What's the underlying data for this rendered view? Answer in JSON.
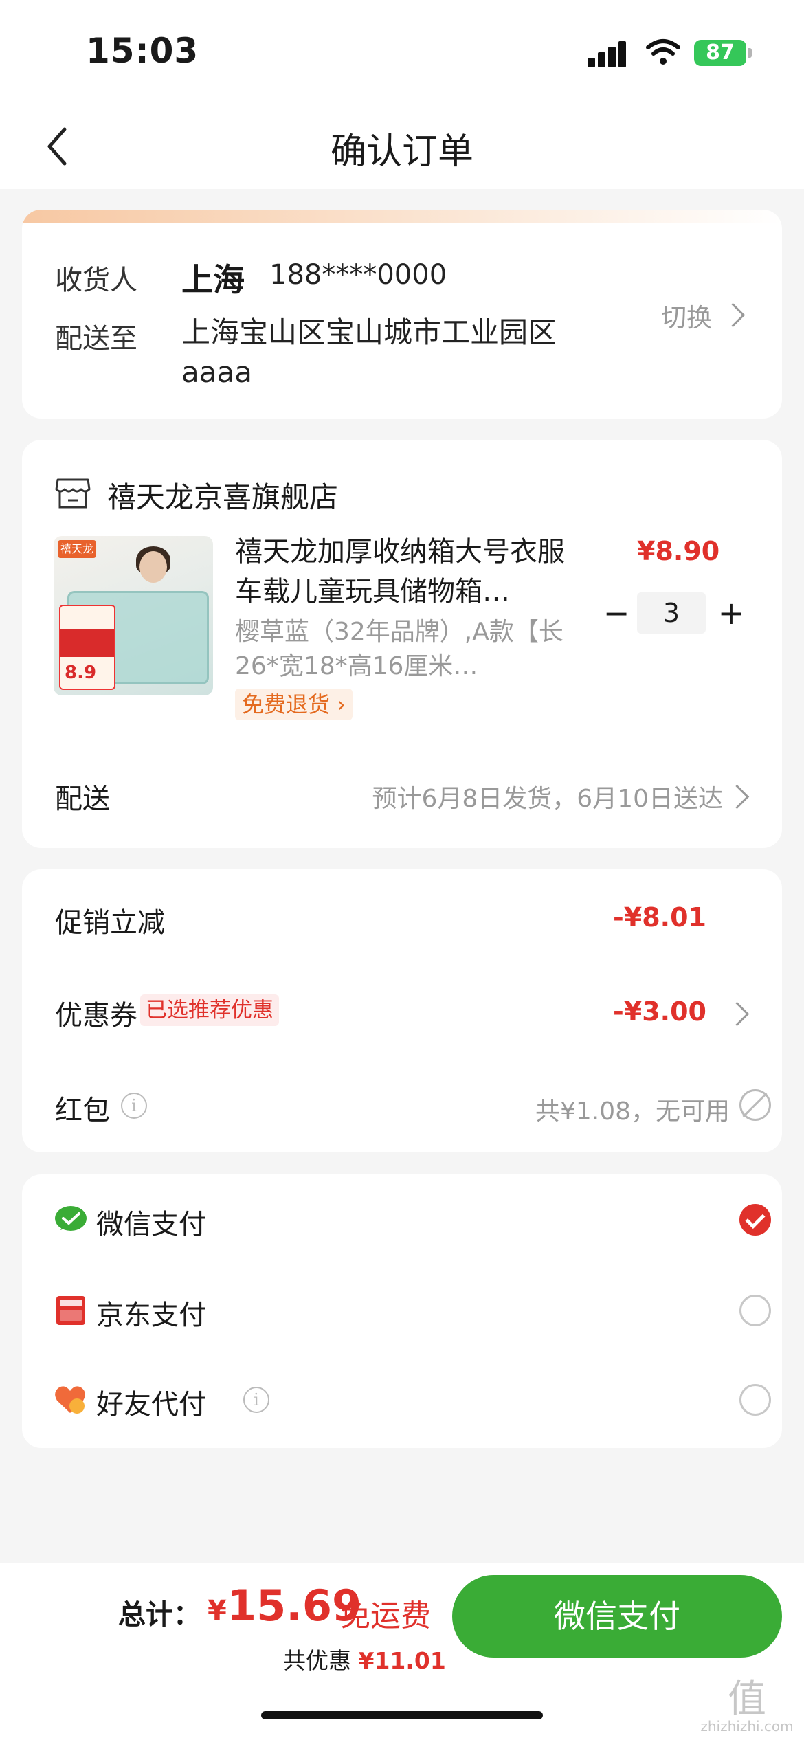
{
  "status_bar": {
    "time": "15:03",
    "battery": "87"
  },
  "nav": {
    "title": "确认订单"
  },
  "address": {
    "receiver_label": "收货人",
    "name": "上海",
    "phone": "188****0000",
    "deliver_label": "配送至",
    "address_line": "上海宝山区宝山城市工业园区aaaa",
    "switch_label": "切换"
  },
  "shop": {
    "name": "禧天龙京喜旗舰店",
    "product": {
      "title": "禧天龙加厚收纳箱大号衣服车载儿童玩具储物箱…",
      "spec": "樱草蓝（32年品牌）,A款【长26*宽18*高16厘米…",
      "free_return": "免费退货",
      "price": "¥8.90",
      "quantity": "3",
      "image_brand": "禧天龙",
      "image_price": "8.9"
    },
    "shipping_label": "配送",
    "shipping_value": "预计6月8日发货，6月10日送达"
  },
  "promotions": {
    "promo_label": "促销立减",
    "promo_amount": "-¥8.01",
    "coupon_label": "优惠券",
    "coupon_tag": "已选推荐优惠",
    "coupon_amount": "-¥3.00",
    "redpack_label": "红包",
    "redpack_value": "共¥1.08，无可用"
  },
  "payment": {
    "options": [
      {
        "label": "微信支付",
        "selected": true
      },
      {
        "label": "京东支付",
        "selected": false
      },
      {
        "label": "好友代付",
        "selected": false
      }
    ]
  },
  "footer": {
    "total_label": "总计：",
    "currency": "¥",
    "total_amount": "15.69",
    "free_shipping": "免运费",
    "discount_label": "共优惠",
    "discount_amount": "¥11.01",
    "pay_button": "微信支付"
  },
  "watermark": {
    "mark": "值",
    "site": "zhizhizhi.com"
  },
  "colors": {
    "accent_red": "#e0312b",
    "wechat_green": "#3aac36"
  },
  "icons": [
    "back-icon",
    "chevron-right-icon",
    "shop-icon",
    "info-icon",
    "ban-icon",
    "wechat-pay-icon",
    "jd-pay-icon",
    "friend-pay-icon",
    "check-icon"
  ]
}
